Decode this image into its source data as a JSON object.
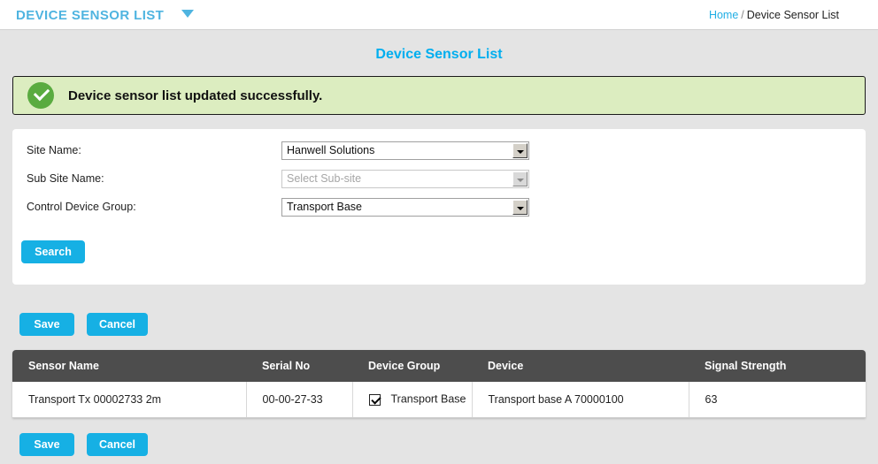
{
  "topbar": {
    "app_title": "DEVICE SENSOR LIST",
    "caret_icon": "chevron-down-icon",
    "breadcrumb": {
      "home": "Home",
      "separator": "/",
      "current": "Device Sensor List"
    }
  },
  "page": {
    "heading": "Device Sensor List"
  },
  "alert": {
    "icon": "check-circle-icon",
    "message": "Device sensor list updated successfully.",
    "background_color": "#dcedc0",
    "icon_color": "#5aab40"
  },
  "search_panel": {
    "fields": [
      {
        "label": "Site Name:",
        "value": "Hanwell Solutions",
        "disabled": false
      },
      {
        "label": "Sub Site Name:",
        "value": "Select Sub-site",
        "disabled": true
      },
      {
        "label": "Control Device Group:",
        "value": "Transport Base",
        "disabled": false
      }
    ],
    "search_button": "Search"
  },
  "actions": {
    "save_label": "Save",
    "cancel_label": "Cancel",
    "accent_color": "#16b0e4"
  },
  "table": {
    "headers": [
      "Sensor Name",
      "Serial No",
      "Device Group",
      "Device",
      "Signal Strength"
    ],
    "rows": [
      {
        "sensor_name": "Transport Tx 00002733 2m",
        "serial_no": "00-00-27-33",
        "device_group_checked": true,
        "device_group": "Transport Base",
        "device": "Transport base A 70000100",
        "signal_strength": "63"
      }
    ]
  }
}
